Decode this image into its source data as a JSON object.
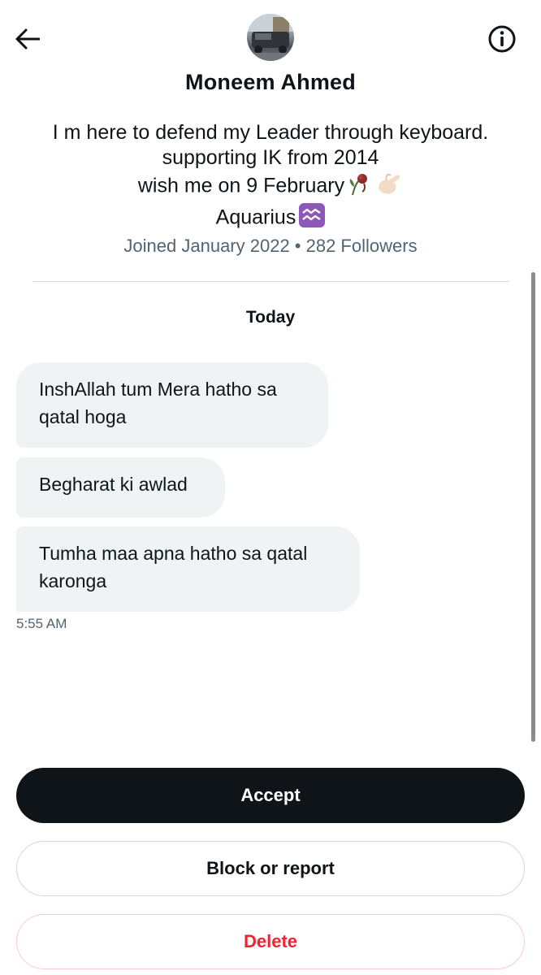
{
  "header": {
    "back_icon": "arrow-left-icon",
    "info_icon": "info-icon",
    "name": "Moneem Ahmed"
  },
  "bio": {
    "line1": "I m here to defend my Leader through keyboard.",
    "line2": "supporting IK from 2014",
    "line3": "wish me on 9 February",
    "line4": "Aquarius",
    "emojis": [
      "wilted-flower-emoji",
      "pinching-hand-emoji",
      "aquarius-emoji"
    ]
  },
  "meta": "Joined January 2022 • 282 Followers",
  "conversation": {
    "day_label": "Today",
    "messages": [
      "InshAllah tum Mera hatho sa qatal hoga",
      "Begharat ki awlad",
      "Tumha maa apna hatho sa qatal karonga"
    ],
    "timestamp": "5:55 AM"
  },
  "actions": {
    "accept": "Accept",
    "block": "Block or report",
    "delete": "Delete"
  },
  "colors": {
    "accept_bg": "#0f1419",
    "delete_text": "#f4212e",
    "bubble_bg": "#eff3f4",
    "secondary_text": "#536471"
  }
}
